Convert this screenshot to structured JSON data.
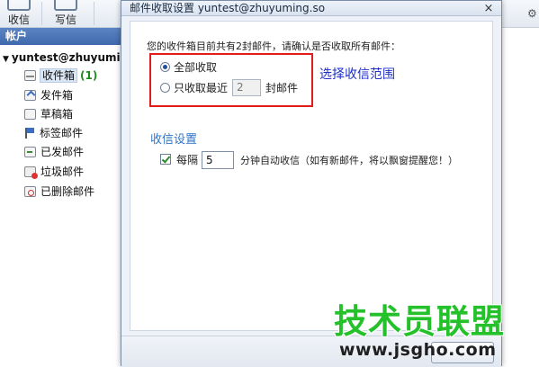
{
  "toolbar": {
    "receive_label": "收信",
    "compose_label": "写信"
  },
  "sidebar": {
    "header": "帐户",
    "account": "yuntest@zhuyuming.so",
    "folders": [
      {
        "label": "收件箱",
        "count": "(1)",
        "icon": "inbox-icon"
      },
      {
        "label": "发件箱",
        "icon": "outbox-icon"
      },
      {
        "label": "草稿箱",
        "icon": "drafts-icon"
      },
      {
        "label": "标签邮件",
        "icon": "flag-icon"
      },
      {
        "label": "已发邮件",
        "icon": "sent-icon"
      },
      {
        "label": "垃圾邮件",
        "icon": "spam-icon"
      },
      {
        "label": "已删除邮件",
        "icon": "deleted-icon"
      }
    ]
  },
  "dialog": {
    "title": "邮件收取设置 yuntest@zhuyuming.so",
    "close_glyph": "×",
    "intro": "您的收件箱目前共有2封邮件，请确认是否收取所有邮件：",
    "option_all": "全部收取",
    "option_recent": "只收取最近",
    "recent_count": "2",
    "recent_unit": "封邮件",
    "selected_option": "all",
    "annotation": "选择收信范围",
    "section_title": "收信设置",
    "interval_checked": true,
    "interval_label": "每隔",
    "interval_value": "5",
    "interval_desc": "分钟自动收信（如有新邮件，将以飘窗提醒您！）"
  },
  "watermark": {
    "main": "技术员联盟",
    "url": "www.jsgho.com"
  },
  "colors": {
    "highlight_box": "#e21b1b",
    "annotation": "#1f2fc9",
    "section_title": "#2f74c8",
    "watermark": "#25c12b"
  }
}
